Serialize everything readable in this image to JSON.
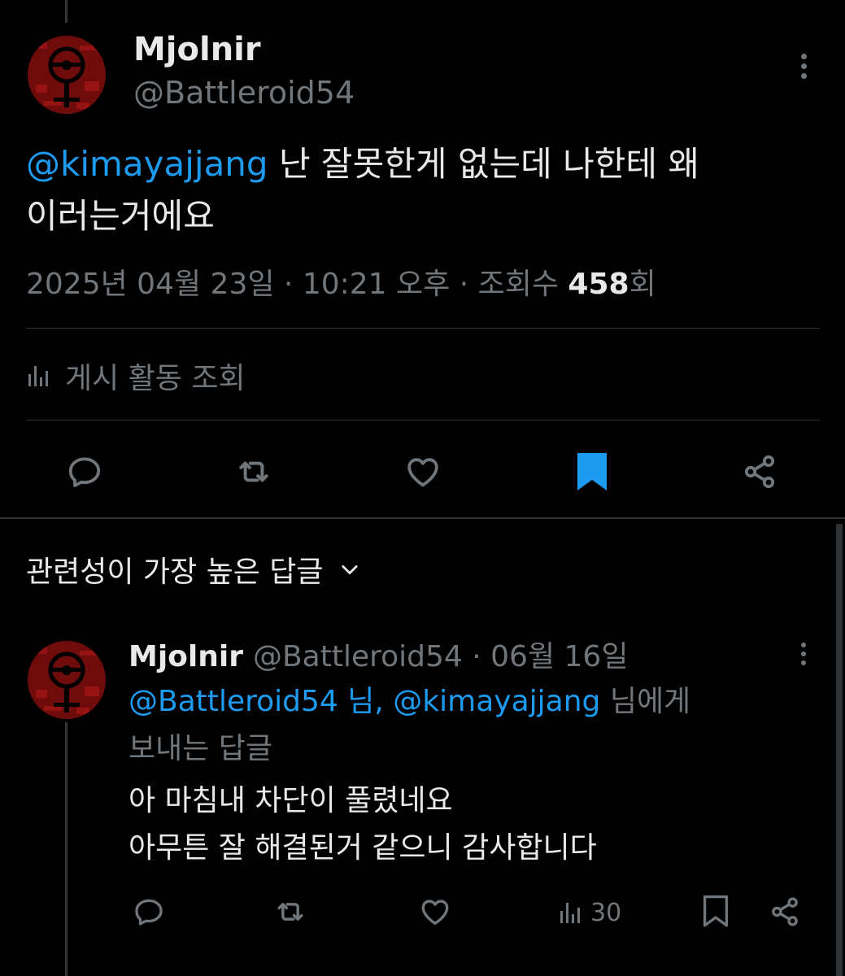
{
  "tweet": {
    "author_name": "Mjolnir",
    "author_handle": "@Battleroid54",
    "mention": "@kimayajjang",
    "text_line1": " 난 잘못한게 없는데 나한테 왜",
    "text_line2": "이러는거에요",
    "date": "2025년 04월 23일",
    "sep1": " · ",
    "time": "10:21 오후",
    "sep2": " · ",
    "views_label": "조회수 ",
    "views_count": "458",
    "views_suffix": "회",
    "activity_label": "게시 활동 조회",
    "bookmarked": true
  },
  "icons": {
    "reply": "reply-bubble-icon",
    "retweet": "retweet-icon",
    "like": "heart-icon",
    "bookmark": "bookmark-icon",
    "share": "share-icon",
    "views": "bar-chart-icon",
    "more": "more-vertical-icon",
    "dropdown": "chevron-down-icon"
  },
  "colors": {
    "accent": "#1d9bf0",
    "muted": "#71767b",
    "text": "#e7e9ea",
    "background": "#000000",
    "avatar_red": "#7a0d0d"
  },
  "replies_section": {
    "sort_label": "관련성이 가장 높은 답글"
  },
  "reply": {
    "author_name": "Mjolnir",
    "header_rest": "@Battleroid54 · 06월 16일",
    "reply_to_mentions": "@Battleroid54 님, @kimayajjang",
    "reply_to_suffix1": " 님에게",
    "reply_to_line2": "보내는 답글",
    "text_line1": "아 마침내 차단이 풀렸네요",
    "text_line2": "아무튼 잘 해결된거 같으니 감사합니다",
    "views_count": "30"
  }
}
